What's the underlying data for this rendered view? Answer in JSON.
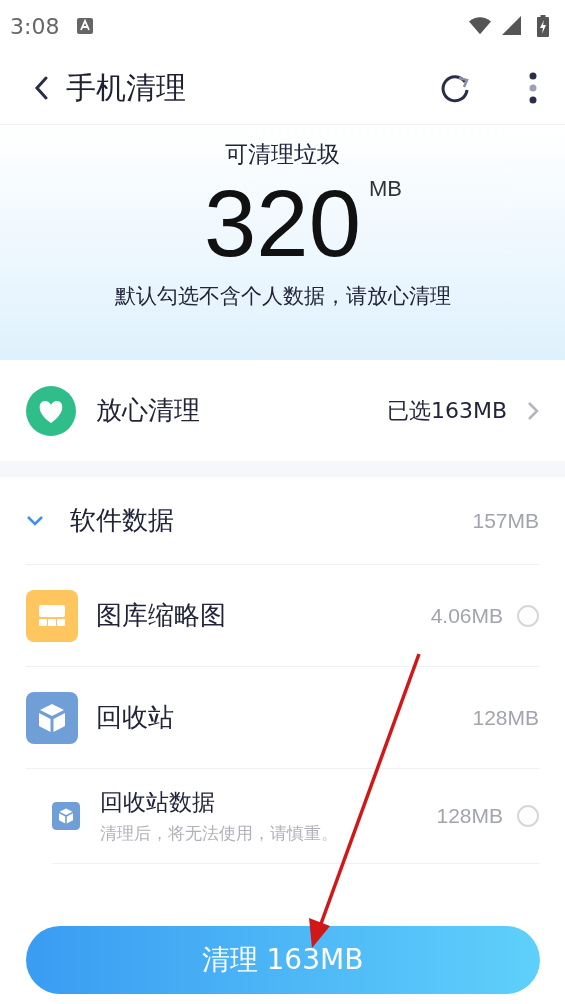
{
  "status_bar": {
    "time": "3:08"
  },
  "header": {
    "title": "手机清理"
  },
  "summary": {
    "label": "可清理垃圾",
    "amount": "320",
    "unit": "MB",
    "note": "默认勾选不含个人数据，请放心清理"
  },
  "safe_clean": {
    "label": "放心清理",
    "selected_size": "已选163MB"
  },
  "list": [
    {
      "kind": "group",
      "name": "软件数据",
      "size": "157MB",
      "expanded": true
    },
    {
      "kind": "item",
      "name": "图库缩略图",
      "size": "4.06MB",
      "checked": false
    },
    {
      "kind": "category",
      "name": "回收站",
      "size": "128MB"
    },
    {
      "kind": "subitem",
      "name": "回收站数据",
      "hint": "清理后，将无法使用，请慎重。",
      "size": "128MB",
      "checked": false
    }
  ],
  "clean_button": {
    "label": "清理 163MB"
  }
}
